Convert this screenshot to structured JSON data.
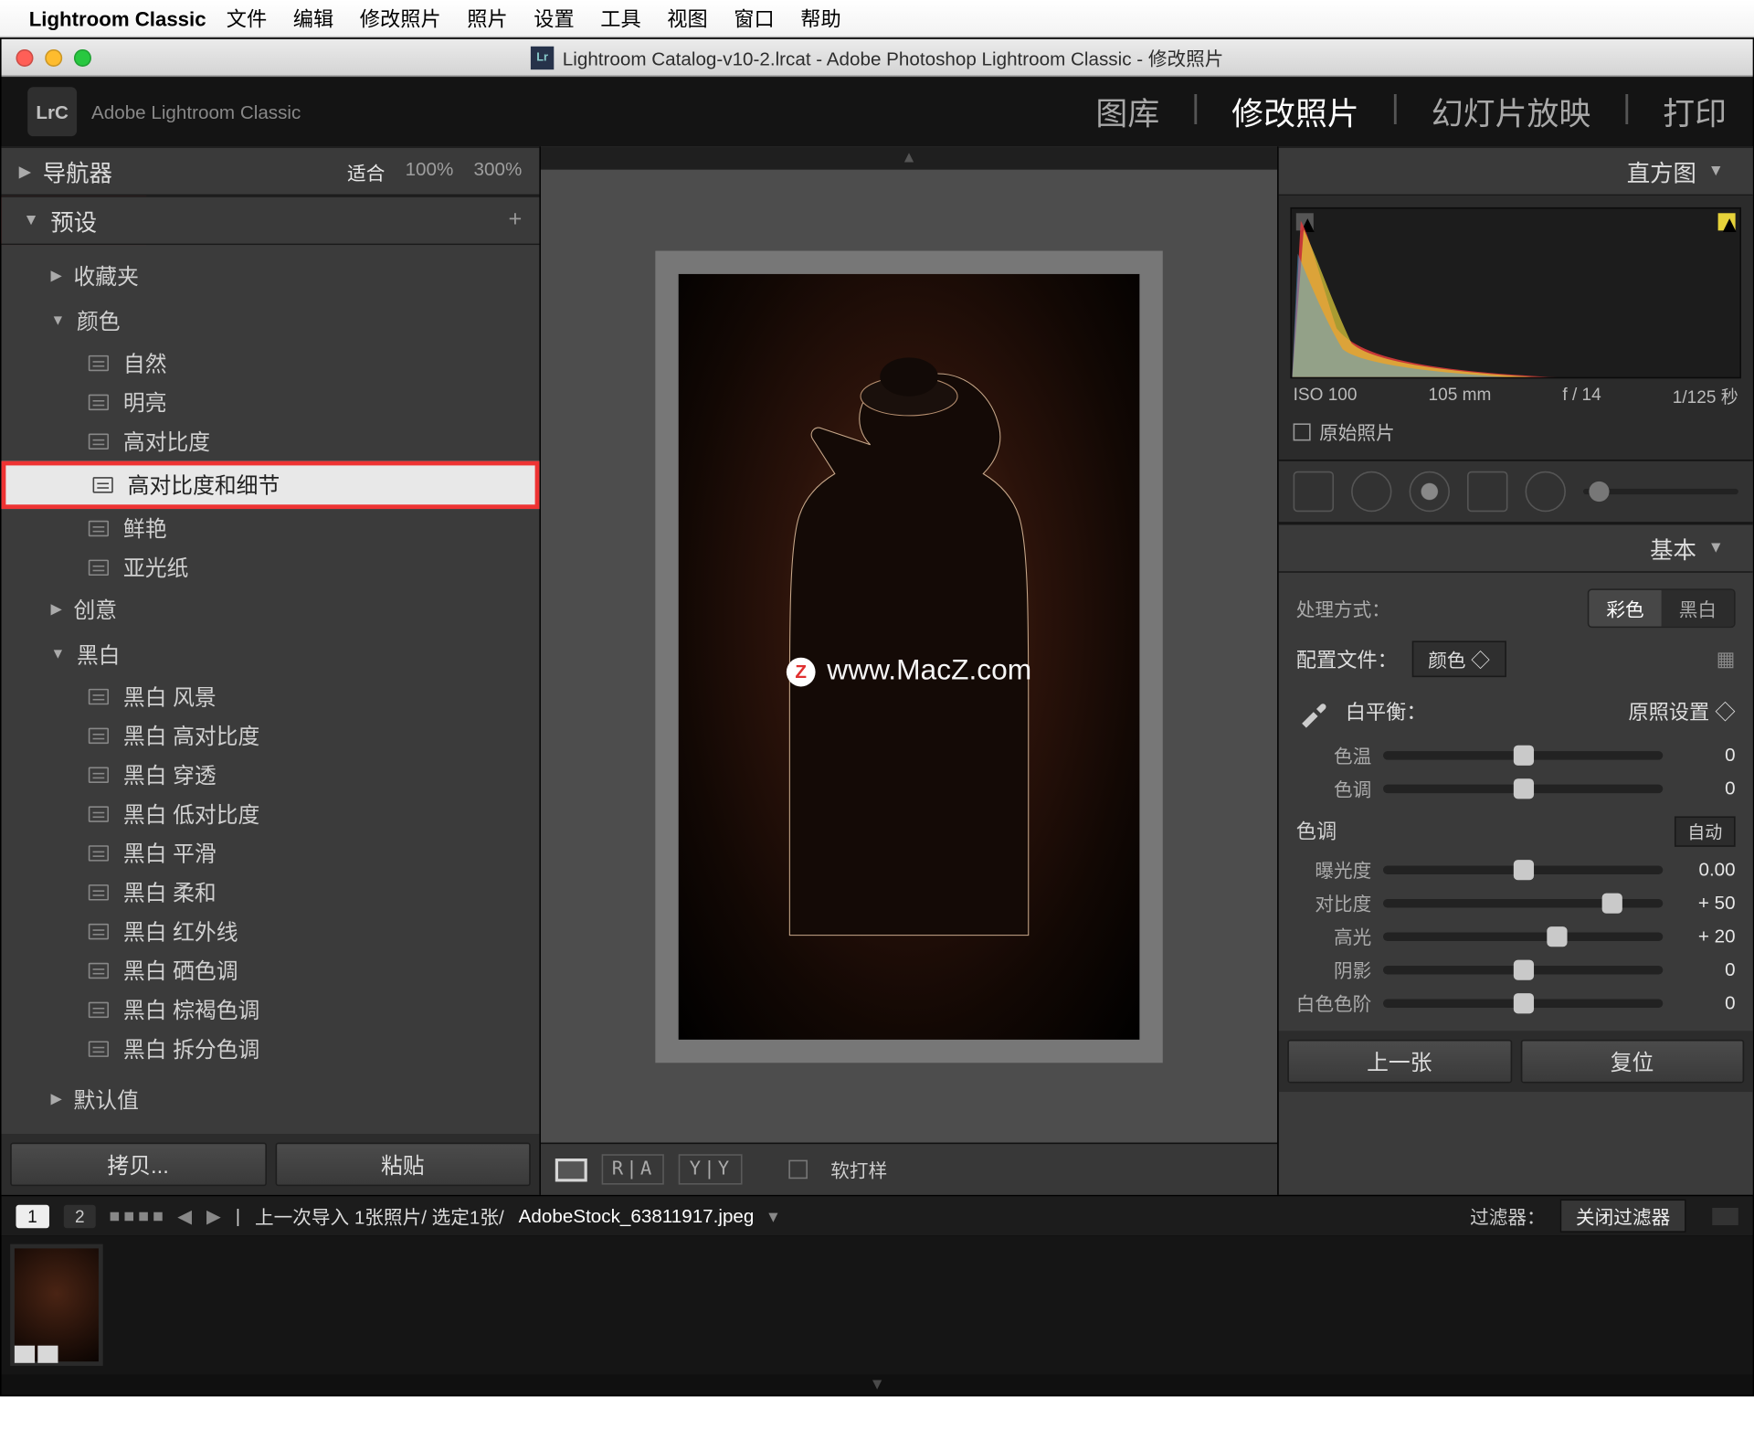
{
  "menubar": {
    "app": "Lightroom Classic",
    "items": [
      "文件",
      "编辑",
      "修改照片",
      "照片",
      "设置",
      "工具",
      "视图",
      "窗口",
      "帮助"
    ]
  },
  "window_title": "Lightroom Catalog-v10-2.lrcat - Adobe Photoshop Lightroom Classic - 修改照片",
  "brand": "Adobe Lightroom Classic",
  "modules": {
    "items": [
      "图库",
      "修改照片",
      "幻灯片放映",
      "打印"
    ],
    "active": 1
  },
  "left": {
    "navigator": {
      "title": "导航器",
      "zoom": [
        "适合",
        "100%",
        "300%"
      ]
    },
    "presets": {
      "title": "预设",
      "groups": [
        {
          "name": "收藏夹",
          "items": []
        },
        {
          "name": "颜色",
          "items": [
            "自然",
            "明亮",
            "高对比度",
            "高对比度和细节",
            "鲜艳",
            "亚光纸"
          ],
          "selected": 3
        },
        {
          "name": "创意",
          "items": []
        },
        {
          "name": "黑白",
          "items": [
            "黑白 风景",
            "黑白 高对比度",
            "黑白 穿透",
            "黑白 低对比度",
            "黑白 平滑",
            "黑白 柔和",
            "黑白 红外线",
            "黑白 硒色调",
            "黑白 棕褐色调",
            "黑白 拆分色调"
          ]
        }
      ],
      "defaults": "默认值"
    },
    "buttons": {
      "copy": "拷贝...",
      "paste": "粘贴"
    }
  },
  "center": {
    "watermark": "www.MacZ.com",
    "toolbar": {
      "ra": "R|A",
      "yy": "Y|Y",
      "softproof": "软打样"
    }
  },
  "right": {
    "histogram": {
      "title": "直方图",
      "iso": "ISO 100",
      "focal": "105 mm",
      "aperture": "f / 14",
      "shutter": "1/125 秒",
      "original": "原始照片"
    },
    "basic": {
      "title": "基本",
      "treatment_label": "处理方式：",
      "treatment": {
        "color": "彩色",
        "bw": "黑白"
      },
      "profile": {
        "label": "配置文件：",
        "value": "颜色"
      },
      "wb": {
        "label": "白平衡：",
        "value": "原照设置"
      },
      "temp": {
        "label": "色温",
        "value": "0",
        "pos": 50
      },
      "tint": {
        "label": "色调",
        "value": "0",
        "pos": 50
      },
      "tone_header": "色调",
      "auto": "自动",
      "exposure": {
        "label": "曝光度",
        "value": "0.00",
        "pos": 50
      },
      "contrast": {
        "label": "对比度",
        "value": "+ 50",
        "pos": 82
      },
      "highlights": {
        "label": "高光",
        "value": "+ 20",
        "pos": 62
      },
      "shadows": {
        "label": "阴影",
        "value": "0",
        "pos": 50
      },
      "whites": {
        "label": "白色色阶",
        "value": "0",
        "pos": 50
      }
    },
    "buttons": {
      "prev": "上一张",
      "reset": "复位"
    }
  },
  "strip": {
    "one": "1",
    "two": "2",
    "info": "上一次导入   1张照片/ 选定1张/",
    "file": "AdobeStock_63811917.jpeg",
    "filter_label": "过滤器：",
    "filter_value": "关闭过滤器"
  }
}
